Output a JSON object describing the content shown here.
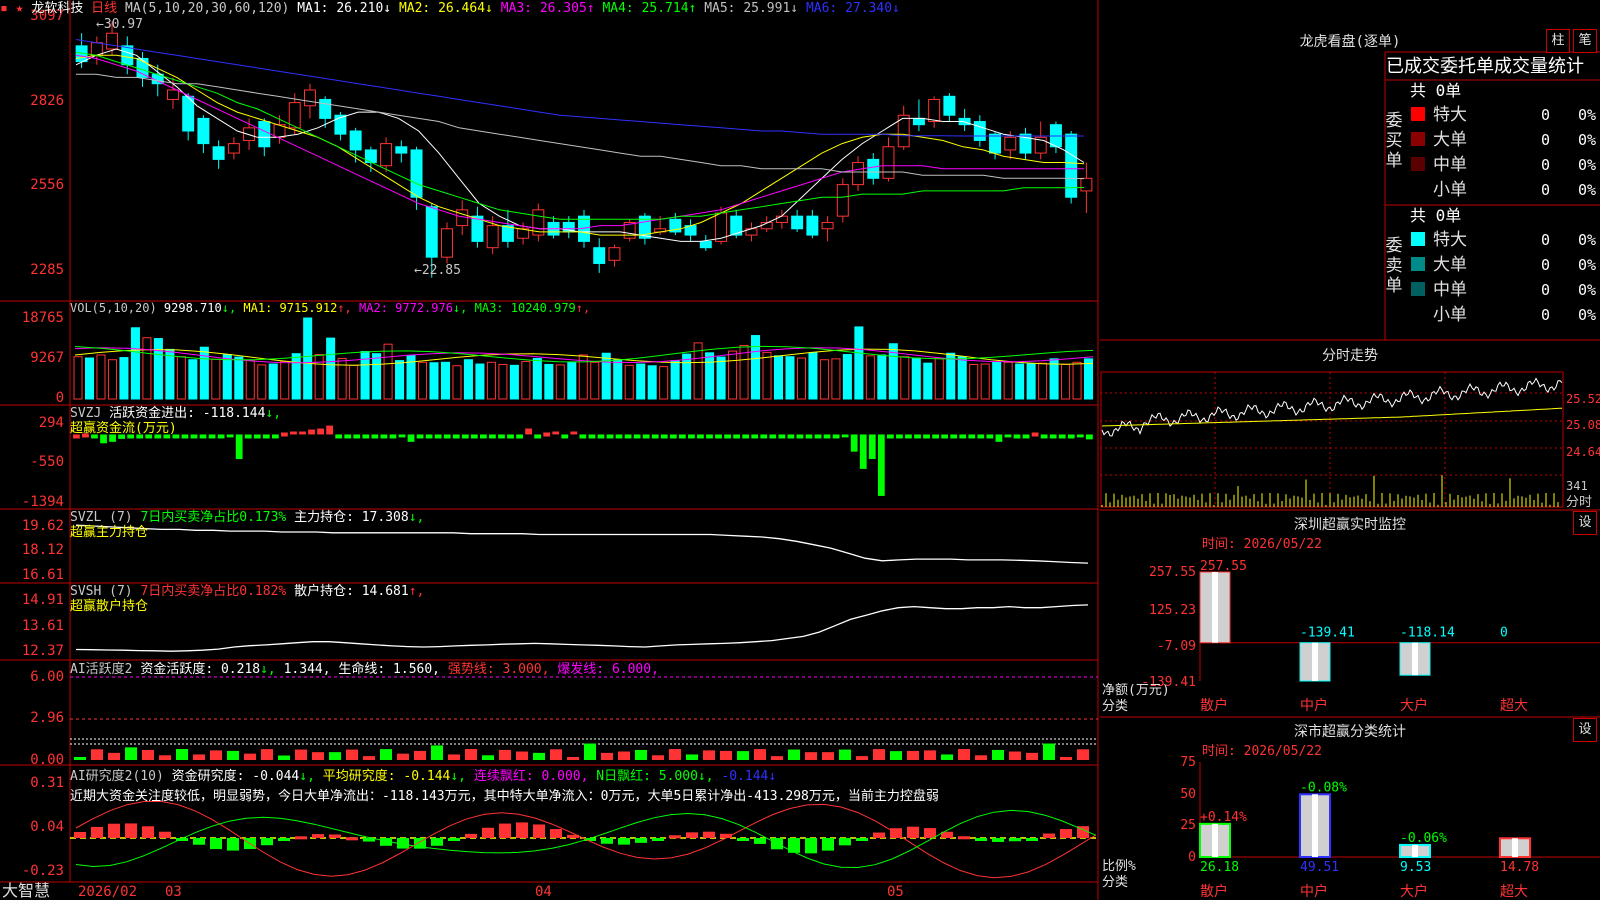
{
  "colors": {
    "up": "#ff3333",
    "down": "#00ffff",
    "grid": "#c00000",
    "ma1": "#ffffff",
    "ma2": "#ffff00",
    "ma3": "#ff00ff",
    "ma4": "#00ff00",
    "ma5": "#c0c0c0",
    "ma6": "#3030ff"
  },
  "app": {
    "brand": "大智慧",
    "stock_name": "龙软科技",
    "period": "日线"
  },
  "main_chart": {
    "ma_label": "MA(5,10,20,30,60,120)",
    "ma": [
      {
        "label": "MA1: 26.210",
        "arrow": "↓",
        "color": "#ffffff"
      },
      {
        "label": "MA2: 26.464",
        "arrow": "↓",
        "color": "#ffff00"
      },
      {
        "label": "MA3: 26.305",
        "arrow": "↑",
        "color": "#ff00ff"
      },
      {
        "label": "MA4: 25.714",
        "arrow": "↑",
        "color": "#00ff00"
      },
      {
        "label": "MA5: 25.991",
        "arrow": "↓",
        "color": "#c0c0c0"
      },
      {
        "label": "MA6: 27.340",
        "arrow": "↓",
        "color": "#3030ff"
      }
    ],
    "yticks": [
      "3097",
      "2826",
      "2556",
      "2285"
    ],
    "high_label": "←30.97",
    "low_label": "←22.85"
  },
  "vol": {
    "label": "VOL(5,10,20)",
    "value": "9298.710",
    "value_arrow": "↓",
    "ma": [
      {
        "label": "MA1: 9715.912",
        "arrow": "↑",
        "color": "#ffff00"
      },
      {
        "label": "MA2: 9772.976",
        "arrow": "↓",
        "color": "#ff00ff"
      },
      {
        "label": "MA3: 10240.979",
        "arrow": "↑",
        "color": "#00ff00"
      }
    ],
    "yticks": [
      "18765",
      "9267",
      "0"
    ]
  },
  "svzj": {
    "label": "SVZJ",
    "title": "活跃资金进出: -118.144",
    "arrow": "↓",
    "sub": "超赢资金流(万元)",
    "yticks": [
      "294",
      "-550",
      "-1394"
    ]
  },
  "svzl": {
    "label": "SVZL (7)",
    "pct": "7日内买卖净占比0.173%",
    "main": "主力持仓: 17.308",
    "arrow": "↓",
    "sub": "超赢主力持仓",
    "yticks": [
      "19.62",
      "18.12",
      "16.61"
    ]
  },
  "svsh": {
    "label": "SVSH (7)",
    "pct": "7日内买卖净占比0.182%",
    "main": "散户持仓: 14.681",
    "arrow": "↑",
    "sub": "超赢散户持仓",
    "yticks": [
      "14.91",
      "13.61",
      "12.37"
    ]
  },
  "ai1": {
    "label": "AI活跃度2",
    "p1": "资金活跃度: 0.218",
    "a1": "↓",
    "p2": "1.344",
    "p3": "生命线: 1.560",
    "p4": "强势线: 3.000",
    "p5": "爆发线: 6.000",
    "yticks": [
      "6.00",
      "2.96",
      "0.00"
    ]
  },
  "ai2": {
    "label": "AI研究度2(10)",
    "p1": "资金研究度: -0.044",
    "a1": "↓",
    "p2": "平均研究度: -0.144",
    "a2": "↓",
    "p3": "连续飘红: 0.000",
    "p4": "N日飘红: 5.000",
    "a4": "↓",
    "p5": "-0.144",
    "a5": "↓",
    "comment": "近期大资金关注度较低，明显弱势，今日大单净流出：-118.143万元，其中特大单净流入：0万元，大单5日累计净出-413.298万元，当前主力控盘弱",
    "yticks": [
      "0.31",
      "0.04",
      "-0.23"
    ]
  },
  "xaxis": [
    "2026/02",
    "03",
    "04",
    "05"
  ],
  "dragon": {
    "title": "龙虎看盘(逐单)",
    "btn1": "柱",
    "btn2": "笔",
    "header": "已成交委托单成交量统计",
    "buy": {
      "side": "委买单",
      "total": "共 0单",
      "rows": [
        {
          "name": "特大",
          "v": "0",
          "p": "0%"
        },
        {
          "name": "大单",
          "v": "0",
          "p": "0%"
        },
        {
          "name": "中单",
          "v": "0",
          "p": "0%"
        },
        {
          "name": "小单",
          "v": "0",
          "p": "0%"
        }
      ]
    },
    "sell": {
      "side": "委卖单",
      "total": "共 0单",
      "rows": [
        {
          "name": "特大",
          "v": "0",
          "p": "0%"
        },
        {
          "name": "大单",
          "v": "0",
          "p": "0%"
        },
        {
          "name": "中单",
          "v": "0",
          "p": "0%"
        },
        {
          "name": "小单",
          "v": "0",
          "p": "0%"
        }
      ]
    }
  },
  "intraday": {
    "title": "分时走势",
    "yticks": [
      "25.52",
      "25.08",
      "24.64"
    ],
    "vol_label": "341",
    "time_label": "分时"
  },
  "monitor": {
    "title": "深圳超赢实时监控",
    "btn": "设",
    "time": "时间: 2026/05/22",
    "unit": "净额(万元)",
    "cat": "分类",
    "yticks": [
      "257.55",
      "125.23",
      "-7.09",
      "-139.41"
    ],
    "bars": [
      {
        "name": "散户",
        "value": 257.55,
        "label": "257.55"
      },
      {
        "name": "中户",
        "value": -139.41,
        "label": "-139.41"
      },
      {
        "name": "大户",
        "value": -118.14,
        "label": "-118.14"
      },
      {
        "name": "超大",
        "value": 0,
        "label": "0"
      }
    ]
  },
  "classify": {
    "title": "深市超赢分类统计",
    "btn": "设",
    "time": "时间: 2026/05/22",
    "unit": "比例%",
    "cat": "分类",
    "yticks": [
      "75",
      "50",
      "25",
      "0"
    ],
    "bars": [
      {
        "name": "散户",
        "value": 26.18,
        "label": "26.18",
        "change": "+0.14%"
      },
      {
        "name": "中户",
        "value": 49.51,
        "label": "49.51",
        "change": "-0.08%"
      },
      {
        "name": "大户",
        "value": 9.53,
        "label": "9.53",
        "change": "-0.06%"
      },
      {
        "name": "超大",
        "value": 14.78,
        "label": "14.78",
        "change": ""
      }
    ]
  },
  "chart_data": {
    "type": "candlestick",
    "price_range": [
      22.3,
      31.4
    ],
    "candles": [
      [
        30.2,
        29.7,
        30.6,
        29.5
      ],
      [
        29.9,
        30.3,
        30.5,
        29.6
      ],
      [
        30.1,
        30.6,
        30.97,
        29.9
      ],
      [
        30.2,
        29.6,
        30.5,
        29.3
      ],
      [
        29.8,
        29.2,
        30.0,
        28.9
      ],
      [
        29.3,
        29.0,
        29.6,
        28.6
      ],
      [
        28.5,
        28.8,
        29.2,
        28.2
      ],
      [
        28.6,
        27.5,
        28.7,
        27.2
      ],
      [
        27.9,
        27.1,
        28.0,
        26.8
      ],
      [
        27.0,
        26.6,
        27.2,
        26.3
      ],
      [
        26.8,
        27.1,
        27.3,
        26.6
      ],
      [
        27.2,
        27.6,
        27.9,
        26.9
      ],
      [
        27.8,
        27.0,
        27.9,
        26.7
      ],
      [
        27.3,
        27.7,
        28.0,
        27.1
      ],
      [
        27.6,
        28.4,
        28.7,
        27.4
      ],
      [
        28.3,
        28.8,
        29.0,
        27.9
      ],
      [
        28.5,
        27.9,
        28.6,
        27.6
      ],
      [
        28.0,
        27.4,
        28.1,
        27.2
      ],
      [
        27.5,
        26.9,
        27.6,
        26.5
      ],
      [
        26.9,
        26.5,
        27.0,
        26.2
      ],
      [
        26.4,
        27.1,
        27.3,
        26.2
      ],
      [
        27.0,
        26.8,
        27.2,
        26.5
      ],
      [
        26.9,
        25.4,
        27.0,
        25.0
      ],
      [
        25.1,
        23.5,
        25.2,
        22.85
      ],
      [
        23.5,
        24.4,
        24.6,
        23.3
      ],
      [
        24.5,
        25.0,
        25.3,
        24.2
      ],
      [
        24.8,
        24.0,
        25.1,
        23.8
      ],
      [
        23.8,
        24.5,
        24.8,
        23.6
      ],
      [
        24.5,
        24.0,
        25.0,
        23.8
      ],
      [
        24.1,
        24.4,
        24.6,
        23.9
      ],
      [
        24.2,
        25.0,
        25.2,
        24.0
      ],
      [
        24.6,
        24.2,
        24.8,
        24.1
      ],
      [
        24.6,
        24.3,
        24.8,
        24.1
      ],
      [
        24.8,
        24.0,
        25.0,
        23.8
      ],
      [
        23.8,
        23.3,
        24.1,
        23.0
      ],
      [
        23.4,
        23.8,
        23.9,
        23.2
      ],
      [
        24.1,
        24.6,
        24.7,
        24.0
      ],
      [
        24.8,
        24.1,
        24.9,
        23.9
      ],
      [
        24.3,
        24.4,
        24.8,
        24.2
      ],
      [
        24.7,
        24.3,
        24.9,
        24.2
      ],
      [
        24.5,
        24.2,
        24.7,
        24.0
      ],
      [
        24.0,
        23.8,
        24.2,
        23.7
      ],
      [
        24.0,
        24.9,
        25.1,
        23.9
      ],
      [
        24.8,
        24.2,
        25.0,
        24.1
      ],
      [
        24.2,
        24.4,
        24.6,
        24.0
      ],
      [
        24.4,
        24.6,
        24.8,
        24.3
      ],
      [
        24.6,
        24.8,
        25.0,
        24.4
      ],
      [
        24.8,
        24.4,
        25.0,
        24.3
      ],
      [
        24.8,
        24.2,
        25.0,
        24.1
      ],
      [
        24.4,
        24.6,
        24.8,
        24.0
      ],
      [
        24.8,
        25.8,
        26.0,
        24.6
      ],
      [
        25.8,
        26.5,
        26.7,
        25.6
      ],
      [
        26.6,
        26.0,
        26.8,
        25.8
      ],
      [
        26.0,
        27.0,
        27.3,
        25.9
      ],
      [
        27.0,
        28.0,
        28.3,
        26.9
      ],
      [
        27.9,
        27.7,
        28.5,
        27.5
      ],
      [
        27.8,
        28.5,
        28.6,
        27.6
      ],
      [
        28.6,
        28.0,
        28.7,
        27.8
      ],
      [
        27.9,
        27.7,
        28.2,
        27.5
      ],
      [
        27.8,
        27.2,
        28.0,
        27.0
      ],
      [
        27.4,
        26.8,
        27.5,
        26.6
      ],
      [
        26.9,
        27.3,
        27.5,
        26.6
      ],
      [
        27.4,
        26.8,
        27.6,
        26.6
      ],
      [
        26.8,
        27.3,
        27.8,
        26.6
      ],
      [
        27.7,
        27.0,
        27.8,
        26.8
      ],
      [
        27.4,
        25.4,
        27.5,
        25.2
      ],
      [
        25.6,
        26.0,
        26.5,
        24.9
      ]
    ],
    "ma_series": [
      {
        "name": "MA1",
        "color": "#ffffff",
        "values": [
          29.6,
          29.9,
          30.1,
          29.9,
          29.4,
          28.9,
          28.3,
          27.9,
          27.5,
          27.3,
          27.3,
          27.4,
          27.6,
          27.9,
          28.1,
          28.1,
          27.9,
          27.5,
          26.8,
          26.0,
          25.2,
          24.8,
          24.5,
          24.4,
          24.4,
          24.3,
          24.3,
          24.3,
          24.2,
          24.1,
          24.0,
          24.0,
          24.1,
          24.3,
          24.5,
          24.8,
          25.4,
          26.0,
          26.6,
          27.1,
          27.5,
          27.9,
          27.9,
          27.8,
          27.8,
          27.6,
          27.4,
          27.3,
          27.2,
          26.9,
          26.5
        ]
      },
      {
        "name": "MA2",
        "color": "#ffff00",
        "values": [
          29.8,
          29.9,
          29.9,
          29.8,
          29.5,
          29.2,
          28.8,
          28.4,
          28.1,
          27.9,
          27.7,
          27.5,
          27.3,
          27.0,
          26.6,
          26.2,
          25.8,
          25.4,
          25.1,
          24.9,
          24.7,
          24.5,
          24.4,
          24.3,
          24.3,
          24.3,
          24.2,
          24.2,
          24.2,
          24.3,
          24.4,
          24.6,
          24.9,
          25.2,
          25.6,
          26.0,
          26.4,
          26.8,
          27.1,
          27.3,
          27.4,
          27.4,
          27.3,
          27.2,
          27.0,
          26.9,
          26.7,
          26.6,
          26.5,
          26.5,
          26.46
        ]
      },
      {
        "name": "MA3",
        "color": "#ff00ff",
        "values": [
          29.9,
          29.8,
          29.6,
          29.4,
          29.1,
          28.8,
          28.5,
          28.2,
          27.9,
          27.6,
          27.3,
          27.0,
          26.7,
          26.4,
          26.1,
          25.8,
          25.5,
          25.2,
          25.0,
          24.8,
          24.7,
          24.6,
          24.5,
          24.4,
          24.4,
          24.4,
          24.5,
          24.5,
          24.6,
          24.7,
          24.8,
          24.9,
          25.0,
          25.2,
          25.4,
          25.6,
          25.8,
          26.0,
          26.2,
          26.3,
          26.4,
          26.4,
          26.4,
          26.3,
          26.3,
          26.3,
          26.3,
          26.3,
          26.3,
          26.3,
          26.3
        ]
      },
      {
        "name": "MA4",
        "color": "#00ff00",
        "values": [
          30.0,
          29.9,
          29.7,
          29.5,
          29.3,
          29.1,
          28.9,
          28.7,
          28.4,
          28.2,
          27.9,
          27.6,
          27.3,
          27.0,
          26.7,
          26.4,
          26.1,
          25.8,
          25.6,
          25.4,
          25.2,
          25.0,
          24.9,
          24.8,
          24.7,
          24.7,
          24.7,
          24.7,
          24.7,
          24.7,
          24.8,
          24.8,
          24.9,
          25.0,
          25.1,
          25.2,
          25.3,
          25.4,
          25.4,
          25.5,
          25.5,
          25.5,
          25.6,
          25.6,
          25.6,
          25.6,
          25.6,
          25.7,
          25.7,
          25.7,
          25.71
        ]
      },
      {
        "name": "MA5",
        "color": "#c0c0c0",
        "values": [
          29.3,
          29.3,
          29.2,
          29.2,
          29.1,
          29.0,
          29.0,
          28.9,
          28.8,
          28.7,
          28.6,
          28.5,
          28.4,
          28.3,
          28.2,
          28.1,
          28.0,
          27.9,
          27.8,
          27.6,
          27.5,
          27.4,
          27.3,
          27.2,
          27.1,
          27.0,
          26.9,
          26.8,
          26.7,
          26.7,
          26.6,
          26.5,
          26.4,
          26.4,
          26.3,
          26.3,
          26.3,
          26.3,
          26.2,
          26.2,
          26.2,
          26.2,
          26.1,
          26.1,
          26.1,
          26.1,
          26.0,
          26.0,
          26.0,
          26.0,
          25.99
        ]
      },
      {
        "name": "MA6",
        "color": "#3030ff",
        "values": [
          30.4,
          30.3,
          30.2,
          30.1,
          30.0,
          29.9,
          29.8,
          29.7,
          29.6,
          29.5,
          29.4,
          29.3,
          29.2,
          29.1,
          29.0,
          28.9,
          28.8,
          28.7,
          28.6,
          28.5,
          28.4,
          28.3,
          28.2,
          28.1,
          28.0,
          27.95,
          27.9,
          27.85,
          27.8,
          27.75,
          27.7,
          27.65,
          27.6,
          27.55,
          27.5,
          27.5,
          27.45,
          27.4,
          27.4,
          27.4,
          27.4,
          27.35,
          27.35,
          27.35,
          27.34,
          27.34,
          27.34,
          27.34,
          27.34,
          27.34,
          27.34
        ]
      }
    ],
    "volume": [
      9800,
      9500,
      10200,
      9100,
      9600,
      16500,
      14200,
      14000,
      11500,
      9800,
      9100,
      12000,
      9200,
      10300,
      9700,
      8900,
      7900,
      8100,
      8700,
      10500,
      18765,
      10300,
      14100,
      9400,
      7800,
      11000,
      10500,
      12700,
      8900,
      10100,
      8500,
      8400,
      8500,
      7700,
      9100,
      8100,
      8500,
      8000,
      7800,
      8700,
      9400,
      8000,
      7900,
      8500,
      10200,
      8500,
      10600,
      9100,
      7800,
      8100,
      7700,
      7500,
      8900,
      10400,
      13000,
      10700,
      9700,
      11100,
      12400,
      14700,
      10800,
      10000,
      9800,
      9500,
      10700,
      9100,
      9300,
      10300,
      16700,
      10000,
      10200,
      12800,
      9800,
      9500,
      8300,
      9400,
      10600,
      9800,
      8000,
      8100,
      8500,
      8500,
      8100,
      8200,
      8300,
      9300,
      8000,
      8500,
      9298
    ],
    "svzj": [
      0,
      20,
      -40,
      -180,
      -150,
      -90,
      -40,
      -40,
      -40,
      -40,
      -40,
      -40,
      -40,
      -40,
      -40,
      -40,
      -40,
      -60,
      -500,
      -40,
      -40,
      -40,
      -40,
      40,
      60,
      60,
      100,
      120,
      180,
      -40,
      -40,
      -40,
      -40,
      -40,
      -40,
      -40,
      -60,
      -150,
      -40,
      -40,
      -40,
      -40,
      -40,
      -40,
      -40,
      -40,
      -40,
      -40,
      -40,
      -40,
      120,
      -40,
      40,
      60,
      -40,
      60,
      -40,
      -40,
      -40,
      -40,
      -40,
      -40,
      -40,
      -40,
      -40,
      -40,
      -40,
      -40,
      -40,
      -40,
      -40,
      -40,
      -40,
      -40,
      -40,
      -40,
      -40,
      -40,
      -40,
      -40,
      -40,
      -40,
      -40,
      -40,
      -40,
      -60,
      -350,
      -700,
      -500,
      -1250,
      -40,
      -40,
      -40,
      -40,
      -40,
      -40,
      -40,
      -40,
      -40,
      -40,
      -40,
      -40,
      -150,
      -60,
      -40,
      -40,
      40,
      -40,
      -40,
      -40,
      -40,
      -60,
      -100
    ],
    "svzl": [
      19.55,
      19.5,
      19.45,
      19.4,
      19.35,
      19.3,
      19.3,
      19.25,
      19.25,
      19.2,
      19.2,
      19.2,
      19.15,
      19.15,
      19.15,
      19.1,
      19.1,
      19.1,
      19.1,
      19.1,
      19.1,
      19.1,
      19.1,
      19.05,
      19.05,
      19.05,
      19.05,
      19.0,
      19.0,
      19.0,
      19.0,
      19.0,
      19.0,
      19.0,
      19.0,
      19.0,
      19.0,
      19.0,
      18.95,
      18.9,
      18.85,
      18.75,
      18.6,
      18.4,
      18.2,
      17.9,
      17.6,
      17.45,
      17.5,
      17.55,
      17.55,
      17.55,
      17.5,
      17.5,
      17.5,
      17.48,
      17.45,
      17.4,
      17.35,
      17.31
    ],
    "svsh": [
      12.58,
      12.57,
      12.56,
      12.55,
      12.53,
      12.52,
      12.5,
      12.52,
      12.55,
      12.6,
      12.7,
      12.76,
      12.8,
      12.85,
      12.9,
      12.95,
      12.95,
      12.9,
      12.85,
      12.8,
      12.75,
      12.72,
      12.7,
      12.72,
      12.75,
      12.78,
      12.8,
      12.83,
      12.85,
      12.87,
      12.85,
      12.82,
      12.8,
      12.78,
      12.75,
      12.72,
      12.7,
      12.75,
      12.8,
      12.82,
      12.85,
      12.87,
      12.9,
      12.95,
      13.0,
      13.1,
      13.2,
      13.4,
      13.7,
      14.0,
      14.2,
      14.4,
      14.55,
      14.6,
      14.55,
      14.5,
      14.5,
      14.55,
      14.55,
      14.6,
      14.55,
      14.55,
      14.6,
      14.65,
      14.68
    ]
  }
}
